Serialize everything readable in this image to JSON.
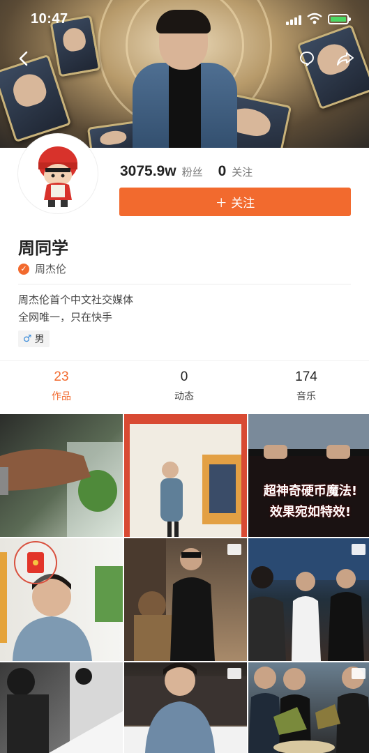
{
  "status_bar": {
    "time": "10:47"
  },
  "profile": {
    "fans_count": "3075.9w",
    "fans_label": "粉丝",
    "following_count": "0",
    "following_label": "关注",
    "follow_button": "＋ 关注",
    "name": "周同学",
    "verified_label": "周杰伦",
    "bio_lines": [
      "周杰伦首个中文社交媒体",
      "全网唯一，只在快手"
    ],
    "gender": "男"
  },
  "tabs": [
    {
      "count": "23",
      "label": "作品",
      "active": true
    },
    {
      "count": "0",
      "label": "动态",
      "active": false
    },
    {
      "count": "174",
      "label": "音乐",
      "active": false
    }
  ],
  "grid": {
    "tile_banner_lines": [
      "超神奇硬币魔法!",
      "效果宛如特效!"
    ]
  },
  "colors": {
    "accent": "#f26a2e",
    "battery": "#4cd964"
  },
  "icons": {
    "back": "back-arrow-icon",
    "comment": "comment-bubble-icon",
    "share": "share-icon",
    "verified": "verified-check-icon",
    "gender": "male-icon",
    "redpacket": "red-packet-icon"
  }
}
